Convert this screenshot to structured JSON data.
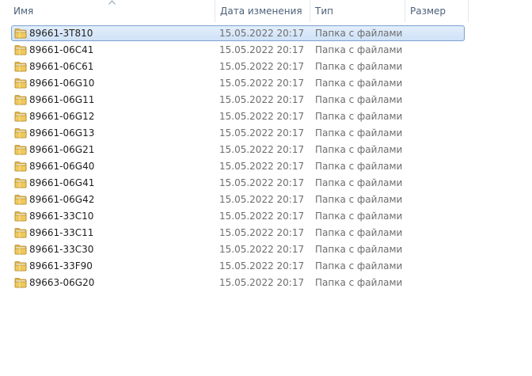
{
  "columns": {
    "name": "Имя",
    "date": "Дата изменения",
    "type": "Тип",
    "size": "Размер"
  },
  "sort": {
    "column": "name",
    "direction": "ascending"
  },
  "colors": {
    "header_text": "#4c607a",
    "selection_border": "#7da2ce",
    "selection_fill": "#cfe2f8",
    "folder": "#e8c15c"
  },
  "files": [
    {
      "name": "89661-3T810",
      "date": "15.05.2022 20:17",
      "type": "Папка с файлами",
      "size": "",
      "icon": "folder-icon",
      "selected": true
    },
    {
      "name": "89661-06C41",
      "date": "15.05.2022 20:17",
      "type": "Папка с файлами",
      "size": "",
      "icon": "folder-icon",
      "selected": false
    },
    {
      "name": "89661-06C61",
      "date": "15.05.2022 20:17",
      "type": "Папка с файлами",
      "size": "",
      "icon": "folder-icon",
      "selected": false
    },
    {
      "name": "89661-06G10",
      "date": "15.05.2022 20:17",
      "type": "Папка с файлами",
      "size": "",
      "icon": "folder-icon",
      "selected": false
    },
    {
      "name": "89661-06G11",
      "date": "15.05.2022 20:17",
      "type": "Папка с файлами",
      "size": "",
      "icon": "folder-icon",
      "selected": false
    },
    {
      "name": "89661-06G12",
      "date": "15.05.2022 20:17",
      "type": "Папка с файлами",
      "size": "",
      "icon": "folder-icon",
      "selected": false
    },
    {
      "name": "89661-06G13",
      "date": "15.05.2022 20:17",
      "type": "Папка с файлами",
      "size": "",
      "icon": "folder-icon",
      "selected": false
    },
    {
      "name": "89661-06G21",
      "date": "15.05.2022 20:17",
      "type": "Папка с файлами",
      "size": "",
      "icon": "folder-icon",
      "selected": false
    },
    {
      "name": "89661-06G40",
      "date": "15.05.2022 20:17",
      "type": "Папка с файлами",
      "size": "",
      "icon": "folder-icon",
      "selected": false
    },
    {
      "name": "89661-06G41",
      "date": "15.05.2022 20:17",
      "type": "Папка с файлами",
      "size": "",
      "icon": "folder-icon",
      "selected": false
    },
    {
      "name": "89661-06G42",
      "date": "15.05.2022 20:17",
      "type": "Папка с файлами",
      "size": "",
      "icon": "folder-icon",
      "selected": false
    },
    {
      "name": "89661-33C10",
      "date": "15.05.2022 20:17",
      "type": "Папка с файлами",
      "size": "",
      "icon": "folder-icon",
      "selected": false
    },
    {
      "name": "89661-33C11",
      "date": "15.05.2022 20:17",
      "type": "Папка с файлами",
      "size": "",
      "icon": "folder-icon",
      "selected": false
    },
    {
      "name": "89661-33C30",
      "date": "15.05.2022 20:17",
      "type": "Папка с файлами",
      "size": "",
      "icon": "folder-icon",
      "selected": false
    },
    {
      "name": "89661-33F90",
      "date": "15.05.2022 20:17",
      "type": "Папка с файлами",
      "size": "",
      "icon": "folder-icon",
      "selected": false
    },
    {
      "name": "89663-06G20",
      "date": "15.05.2022 20:17",
      "type": "Папка с файлами",
      "size": "",
      "icon": "folder-icon",
      "selected": false
    }
  ]
}
